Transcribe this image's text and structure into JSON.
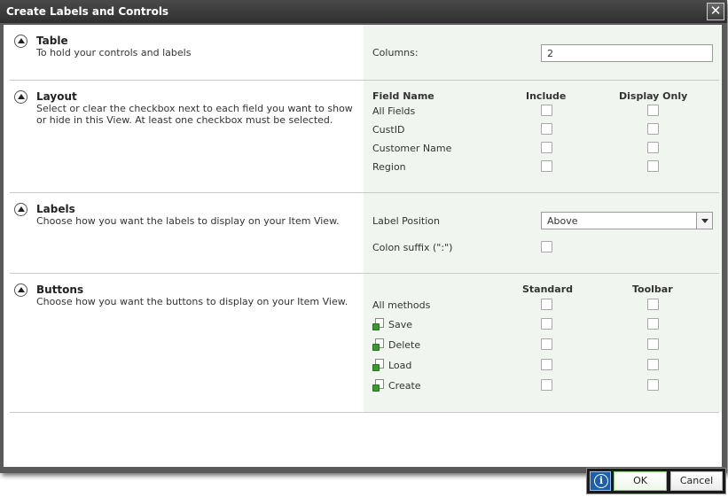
{
  "dialog": {
    "title": "Create Labels and Controls"
  },
  "sections": {
    "table": {
      "title": "Table",
      "description": "To hold your controls and labels",
      "columns_label": "Columns:",
      "columns_value": "2"
    },
    "layout": {
      "title": "Layout",
      "description": "Select or clear the checkbox next to each field you want to show or hide in this View. At least one checkbox must be selected.",
      "headers": {
        "field_name": "Field Name",
        "include": "Include",
        "display_only": "Display Only"
      },
      "fields": [
        "All Fields",
        "CustID",
        "Customer Name",
        "Region"
      ]
    },
    "labels": {
      "title": "Labels",
      "description": "Choose how you want the labels to display on your Item View.",
      "position_label": "Label Position",
      "position_value": "Above",
      "colon_label": "Colon suffix (\":\")"
    },
    "buttons": {
      "title": "Buttons",
      "description": "Choose how you want the buttons to display on your Item View.",
      "headers": {
        "standard": "Standard",
        "toolbar": "Toolbar"
      },
      "all_methods": "All methods",
      "methods": [
        "Save",
        "Delete",
        "Load",
        "Create"
      ]
    }
  },
  "footer": {
    "ok_label": "OK",
    "cancel_label": "Cancel"
  },
  "colors": {
    "title_bar": "#3a3a3a",
    "right_panel": "#f0f5ef",
    "info_button": "#1f5fa8",
    "method_icon": "#3a9a2e"
  }
}
